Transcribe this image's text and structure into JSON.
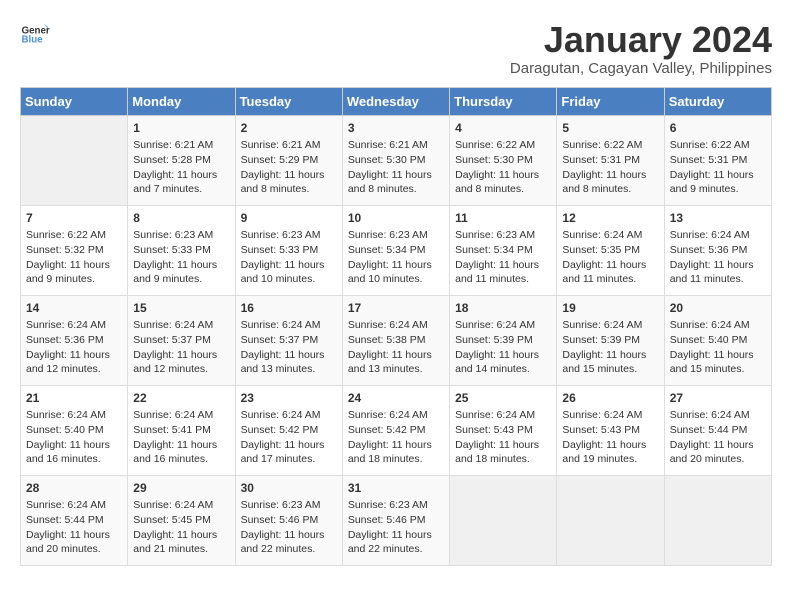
{
  "header": {
    "logo_general": "General",
    "logo_blue": "Blue",
    "title": "January 2024",
    "subtitle": "Daragutan, Cagayan Valley, Philippines"
  },
  "weekdays": [
    "Sunday",
    "Monday",
    "Tuesday",
    "Wednesday",
    "Thursday",
    "Friday",
    "Saturday"
  ],
  "weeks": [
    [
      {
        "day": "",
        "info": ""
      },
      {
        "day": "1",
        "info": "Sunrise: 6:21 AM\nSunset: 5:28 PM\nDaylight: 11 hours\nand 7 minutes."
      },
      {
        "day": "2",
        "info": "Sunrise: 6:21 AM\nSunset: 5:29 PM\nDaylight: 11 hours\nand 8 minutes."
      },
      {
        "day": "3",
        "info": "Sunrise: 6:21 AM\nSunset: 5:30 PM\nDaylight: 11 hours\nand 8 minutes."
      },
      {
        "day": "4",
        "info": "Sunrise: 6:22 AM\nSunset: 5:30 PM\nDaylight: 11 hours\nand 8 minutes."
      },
      {
        "day": "5",
        "info": "Sunrise: 6:22 AM\nSunset: 5:31 PM\nDaylight: 11 hours\nand 8 minutes."
      },
      {
        "day": "6",
        "info": "Sunrise: 6:22 AM\nSunset: 5:31 PM\nDaylight: 11 hours\nand 9 minutes."
      }
    ],
    [
      {
        "day": "7",
        "info": "Sunrise: 6:22 AM\nSunset: 5:32 PM\nDaylight: 11 hours\nand 9 minutes."
      },
      {
        "day": "8",
        "info": "Sunrise: 6:23 AM\nSunset: 5:33 PM\nDaylight: 11 hours\nand 9 minutes."
      },
      {
        "day": "9",
        "info": "Sunrise: 6:23 AM\nSunset: 5:33 PM\nDaylight: 11 hours\nand 10 minutes."
      },
      {
        "day": "10",
        "info": "Sunrise: 6:23 AM\nSunset: 5:34 PM\nDaylight: 11 hours\nand 10 minutes."
      },
      {
        "day": "11",
        "info": "Sunrise: 6:23 AM\nSunset: 5:34 PM\nDaylight: 11 hours\nand 11 minutes."
      },
      {
        "day": "12",
        "info": "Sunrise: 6:24 AM\nSunset: 5:35 PM\nDaylight: 11 hours\nand 11 minutes."
      },
      {
        "day": "13",
        "info": "Sunrise: 6:24 AM\nSunset: 5:36 PM\nDaylight: 11 hours\nand 11 minutes."
      }
    ],
    [
      {
        "day": "14",
        "info": "Sunrise: 6:24 AM\nSunset: 5:36 PM\nDaylight: 11 hours\nand 12 minutes."
      },
      {
        "day": "15",
        "info": "Sunrise: 6:24 AM\nSunset: 5:37 PM\nDaylight: 11 hours\nand 12 minutes."
      },
      {
        "day": "16",
        "info": "Sunrise: 6:24 AM\nSunset: 5:37 PM\nDaylight: 11 hours\nand 13 minutes."
      },
      {
        "day": "17",
        "info": "Sunrise: 6:24 AM\nSunset: 5:38 PM\nDaylight: 11 hours\nand 13 minutes."
      },
      {
        "day": "18",
        "info": "Sunrise: 6:24 AM\nSunset: 5:39 PM\nDaylight: 11 hours\nand 14 minutes."
      },
      {
        "day": "19",
        "info": "Sunrise: 6:24 AM\nSunset: 5:39 PM\nDaylight: 11 hours\nand 15 minutes."
      },
      {
        "day": "20",
        "info": "Sunrise: 6:24 AM\nSunset: 5:40 PM\nDaylight: 11 hours\nand 15 minutes."
      }
    ],
    [
      {
        "day": "21",
        "info": "Sunrise: 6:24 AM\nSunset: 5:40 PM\nDaylight: 11 hours\nand 16 minutes."
      },
      {
        "day": "22",
        "info": "Sunrise: 6:24 AM\nSunset: 5:41 PM\nDaylight: 11 hours\nand 16 minutes."
      },
      {
        "day": "23",
        "info": "Sunrise: 6:24 AM\nSunset: 5:42 PM\nDaylight: 11 hours\nand 17 minutes."
      },
      {
        "day": "24",
        "info": "Sunrise: 6:24 AM\nSunset: 5:42 PM\nDaylight: 11 hours\nand 18 minutes."
      },
      {
        "day": "25",
        "info": "Sunrise: 6:24 AM\nSunset: 5:43 PM\nDaylight: 11 hours\nand 18 minutes."
      },
      {
        "day": "26",
        "info": "Sunrise: 6:24 AM\nSunset: 5:43 PM\nDaylight: 11 hours\nand 19 minutes."
      },
      {
        "day": "27",
        "info": "Sunrise: 6:24 AM\nSunset: 5:44 PM\nDaylight: 11 hours\nand 20 minutes."
      }
    ],
    [
      {
        "day": "28",
        "info": "Sunrise: 6:24 AM\nSunset: 5:44 PM\nDaylight: 11 hours\nand 20 minutes."
      },
      {
        "day": "29",
        "info": "Sunrise: 6:24 AM\nSunset: 5:45 PM\nDaylight: 11 hours\nand 21 minutes."
      },
      {
        "day": "30",
        "info": "Sunrise: 6:23 AM\nSunset: 5:46 PM\nDaylight: 11 hours\nand 22 minutes."
      },
      {
        "day": "31",
        "info": "Sunrise: 6:23 AM\nSunset: 5:46 PM\nDaylight: 11 hours\nand 22 minutes."
      },
      {
        "day": "",
        "info": ""
      },
      {
        "day": "",
        "info": ""
      },
      {
        "day": "",
        "info": ""
      }
    ]
  ]
}
